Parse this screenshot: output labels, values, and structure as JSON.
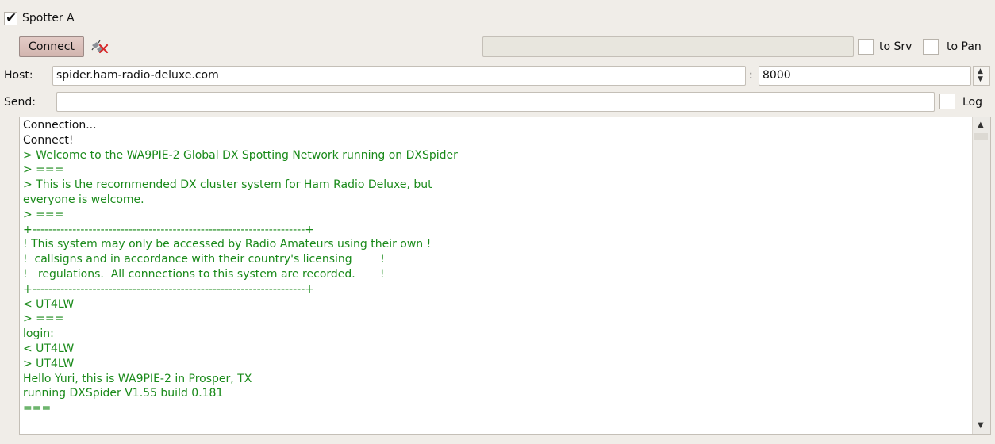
{
  "colors": {
    "log_black": "#111111",
    "log_green": "#1a8a1a",
    "button_bg": "#dcc1bb"
  },
  "header": {
    "spotter_checked": true,
    "spotter_label": "Spotter A"
  },
  "toolbar": {
    "connect_label": "Connect",
    "disconnect_icon": "disconnect-icon",
    "status_value": "",
    "to_srv_label": "to Srv",
    "to_srv_checked": false,
    "to_pan_label": "to Pan",
    "to_pan_checked": false
  },
  "host": {
    "label": "Host:",
    "value": "spider.ham-radio-deluxe.com",
    "colon": ":",
    "port": "8000"
  },
  "send": {
    "label": "Send:",
    "value": "",
    "log_label": "Log",
    "log_checked": false
  },
  "log": [
    {
      "text": "Connection...",
      "color": "black"
    },
    {
      "text": "Connect!",
      "color": "black"
    },
    {
      "text": "> Welcome to the WA9PIE-2 Global DX Spotting Network running on DXSpider",
      "color": "green"
    },
    {
      "text": "> ===",
      "color": "green"
    },
    {
      "text": "> This is the recommended DX cluster system for Ham Radio Deluxe, but",
      "color": "green"
    },
    {
      "text": "everyone is welcome.",
      "color": "green"
    },
    {
      "text": "> ===",
      "color": "green"
    },
    {
      "text": "+--------------------------------------------------------------------+",
      "color": "green"
    },
    {
      "text": "! This system may only be accessed by Radio Amateurs using their own !",
      "color": "green"
    },
    {
      "text": "!  callsigns and in accordance with their country's licensing        !",
      "color": "green"
    },
    {
      "text": "!   regulations.  All connections to this system are recorded.       !",
      "color": "green"
    },
    {
      "text": "+--------------------------------------------------------------------+",
      "color": "green"
    },
    {
      "text": "< UT4LW",
      "color": "green"
    },
    {
      "text": "> ===",
      "color": "green"
    },
    {
      "text": "login:",
      "color": "green"
    },
    {
      "text": "< UT4LW",
      "color": "green"
    },
    {
      "text": "> UT4LW",
      "color": "green"
    },
    {
      "text": "Hello Yuri, this is WA9PIE-2 in Prosper, TX",
      "color": "green"
    },
    {
      "text": "running DXSpider V1.55 build 0.181",
      "color": "green"
    },
    {
      "text": "===",
      "color": "green"
    }
  ]
}
